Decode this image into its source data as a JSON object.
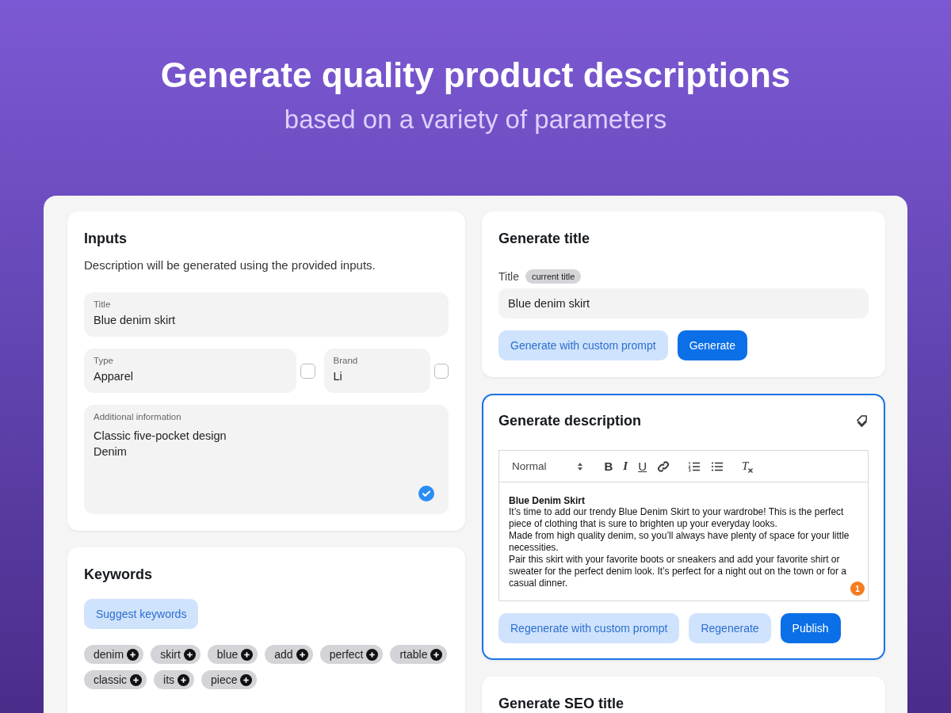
{
  "hero": {
    "headline": "Generate quality product descriptions",
    "subline": "based on a variety of parameters"
  },
  "inputs": {
    "title": "Inputs",
    "intro": "Description will be generated using the provided inputs.",
    "title_field": {
      "label": "Title",
      "value": "Blue denim skirt"
    },
    "type_field": {
      "label": "Type",
      "value": "Apparel",
      "checked": false
    },
    "brand_field": {
      "label": "Brand",
      "value": "Li",
      "checked": false
    },
    "additional": {
      "label": "Additional information",
      "lines": [
        "Classic five-pocket design",
        "Denim"
      ],
      "confirmed": true
    }
  },
  "keywords": {
    "title": "Keywords",
    "button": "Suggest keywords",
    "chips": [
      {
        "label": "denim"
      },
      {
        "label": "skirt"
      },
      {
        "label": "blue"
      },
      {
        "label": "add"
      },
      {
        "label": "perfect"
      },
      {
        "label": "rtable"
      },
      {
        "label": "classic"
      },
      {
        "label": "its"
      },
      {
        "label": "piece"
      }
    ]
  },
  "generate_title": {
    "title": "Generate title",
    "focused": false,
    "field_label": "Title",
    "badge": "current title",
    "value": "Blue denim skirt",
    "buttons": [
      {
        "label": "Generate with custom prompt",
        "kind": "secondary"
      },
      {
        "label": "Generate",
        "kind": "primary"
      }
    ]
  },
  "generate_description": {
    "title": "Generate description",
    "focused": true,
    "format": "Normal",
    "toolbar": [
      {
        "kind": "bold",
        "label": "B"
      },
      {
        "kind": "italic",
        "label": "I"
      },
      {
        "kind": "underline",
        "label": "U"
      },
      {
        "kind": "link"
      },
      {
        "kind": "ordered-list"
      },
      {
        "kind": "bullet-list"
      },
      {
        "kind": "clear",
        "label": "T"
      }
    ],
    "heading": "Blue Denim Skirt",
    "paragraphs": [
      "It’s time to add our trendy Blue Denim Skirt to your wardrobe! This is the perfect piece of clothing that is sure to brighten up your everyday looks.",
      "Made from high quality denim, so you’ll always have plenty of space for your little necessities.",
      "Pair this skirt with your favorite boots or sneakers and add your favorite shirt or sweater for the perfect denim look. It’s perfect for a night out on the town or for a casual dinner."
    ],
    "count": "1",
    "buttons": [
      {
        "label": "Regenerate with custom prompt",
        "kind": "secondary"
      },
      {
        "label": "Regenerate",
        "kind": "secondary"
      },
      {
        "label": "Publish",
        "kind": "primary"
      }
    ]
  },
  "seo_title": {
    "title": "Generate SEO title",
    "focused": false
  }
}
